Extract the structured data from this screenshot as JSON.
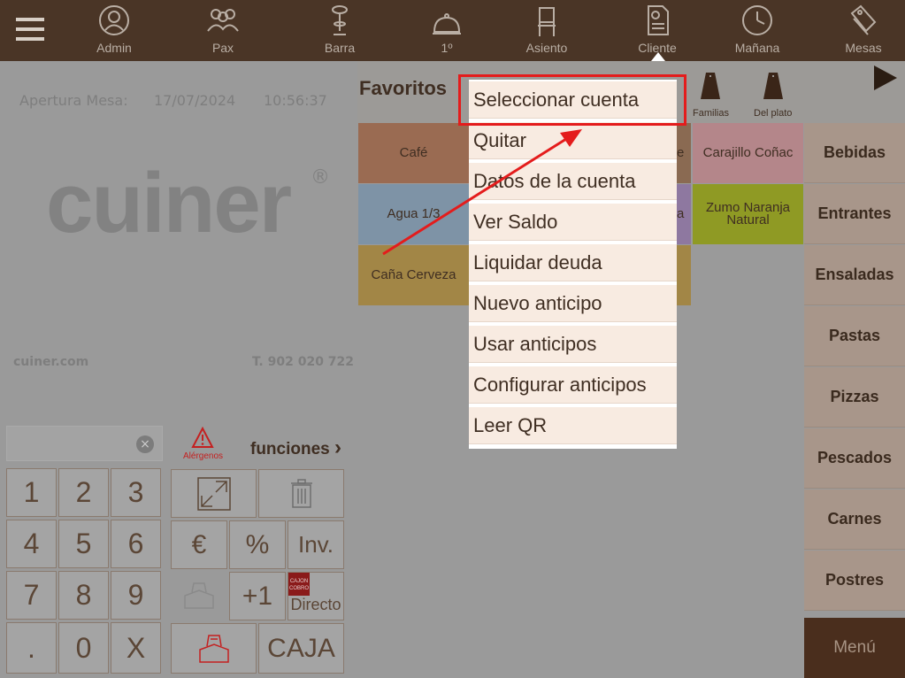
{
  "topbar": {
    "items": [
      {
        "label": "Admin",
        "icon": "admin-user-icon"
      },
      {
        "label": "Pax",
        "icon": "pax-people-icon"
      },
      {
        "label": "Barra",
        "icon": "bar-stool-icon"
      },
      {
        "label": "1º",
        "icon": "cloche-icon"
      },
      {
        "label": "Asiento",
        "icon": "chair-icon"
      },
      {
        "label": "Cliente",
        "icon": "client-document-icon"
      },
      {
        "label": "Mañana",
        "icon": "clock-icon"
      },
      {
        "label": "Mesas",
        "icon": "tags-icon"
      }
    ]
  },
  "left": {
    "apertura_label": "Apertura Mesa:",
    "apertura_date": "17/07/2024",
    "apertura_time": "10:56:37",
    "logo": "cuiner",
    "logo_reg": "®",
    "website": "cuiner.com",
    "phone": "T. 902 020 722",
    "alergenos": "Alérgenos",
    "funciones": "funciones",
    "keypad": [
      "1",
      "2",
      "3",
      "4",
      "5",
      "6",
      "7",
      "8",
      "9",
      ".",
      "0",
      "X"
    ],
    "func_keys": {
      "euro": "€",
      "percent": "%",
      "inv": "Inv.",
      "plus_one": "+1",
      "directo": "Directo",
      "cajon_line1": "CAJON",
      "cajon_line2": "COBRO",
      "caja": "CAJA"
    }
  },
  "favoritos": {
    "title": "Favoritos",
    "familias": "Familias",
    "del_plato": "Del plato",
    "tiles": [
      {
        "label": "Café",
        "color": "#9a6b52"
      },
      {
        "label": "e",
        "color": "#8a6a52"
      },
      {
        "label": "Carajillo Coñac",
        "color": "#b4868a"
      },
      {
        "label": "Agua 1/3",
        "color": "#7e93a6"
      },
      {
        "label": "a",
        "color": "#8e78a0"
      },
      {
        "label": "Zumo Naranja Natural",
        "color": "#8f9a24"
      },
      {
        "label": "Caña Cerveza",
        "color": "#a28646"
      }
    ]
  },
  "categories": [
    "Bebidas",
    "Entrantes",
    "Ensaladas",
    "Pastas",
    "Pizzas",
    "Pescados",
    "Carnes",
    "Postres"
  ],
  "menu_button": "Menú",
  "dropdown": {
    "items": [
      "Seleccionar cuenta",
      "Quitar",
      "Datos de la cuenta",
      "Ver Saldo",
      "Liquidar deuda",
      "Nuevo anticipo",
      "Usar anticipos",
      "Configurar anticipos",
      "Leer QR"
    ]
  },
  "colors": {
    "topbar": "#4a3526",
    "highlight": "#e41c1c",
    "menu_item_bg": "#f8ebe1"
  }
}
